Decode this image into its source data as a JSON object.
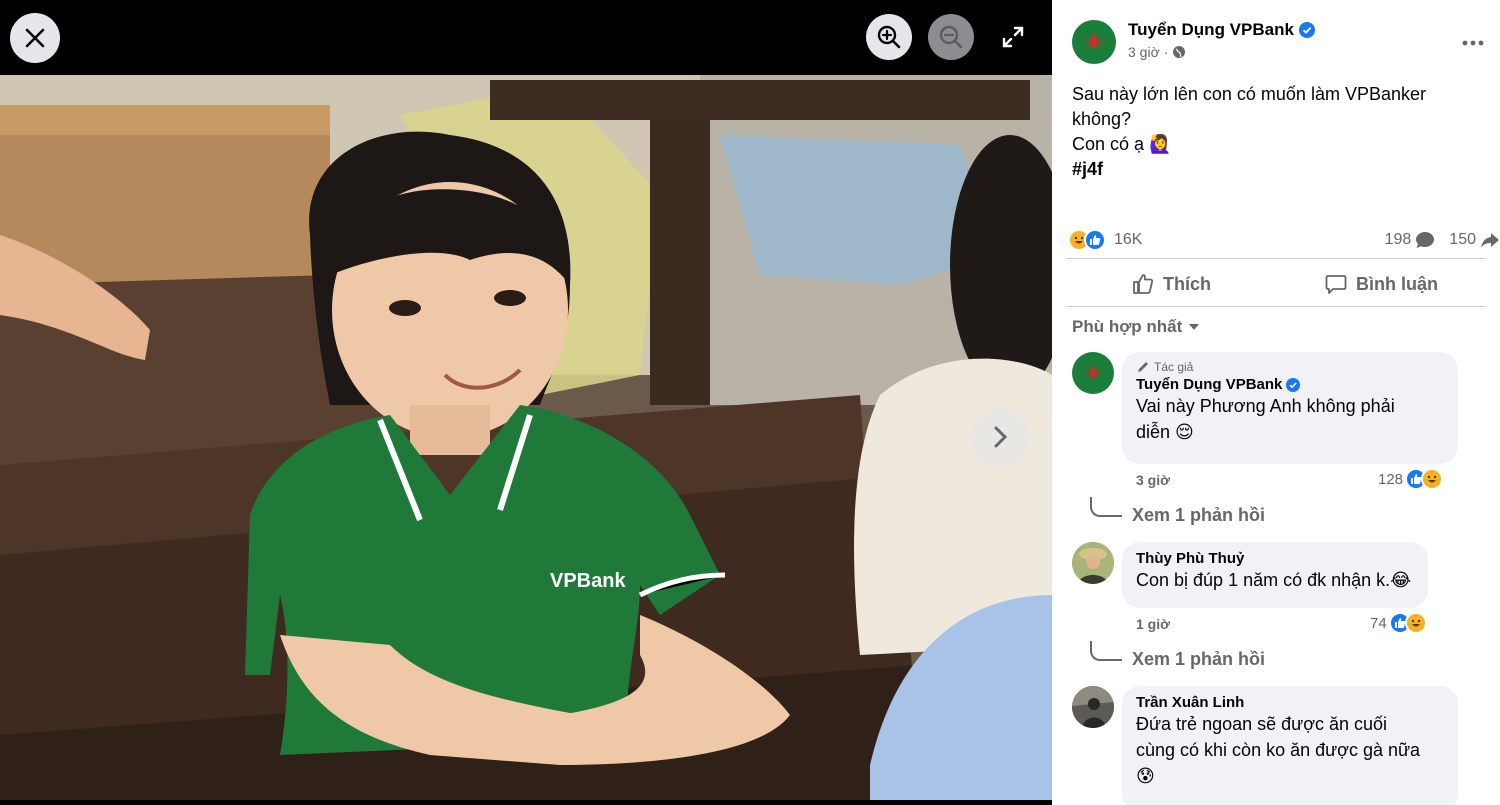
{
  "viewer": {
    "close_icon": "close-icon",
    "zoom_in_icon": "zoom-in-icon",
    "zoom_out_icon": "zoom-out-icon",
    "fullscreen_icon": "fullscreen-icon",
    "next_icon": "chevron-right-icon",
    "photo_shirt_logo": "VPBank"
  },
  "post": {
    "page_name": "Tuyển Dụng VPBank",
    "time": "3 giờ",
    "text_lines": [
      "Sau này lớn lên con có muốn làm VPBanker",
      "không?",
      "Con có ạ 🙋‍♀️"
    ],
    "hashtag": "#j4f",
    "reaction_count": "16K",
    "comment_count": "198",
    "share_count": "150",
    "like_label": "Thích",
    "comment_label": "Bình luận",
    "sort_label": "Phù hợp nhất"
  },
  "comments": [
    {
      "author_tag": "Tác giả",
      "name": "Tuyển Dụng VPBank",
      "text_line1": "Vai này Phương Anh không phải",
      "text_line2": "diễn 😌",
      "time": "3 giờ",
      "reactions": "128",
      "reply_label": "Xem 1 phản hồi"
    },
    {
      "name": "Thùy Phù Thuỷ",
      "text_line1": "Con bị đúp 1 năm có đk nhận k.😂",
      "time": "1 giờ",
      "reactions": "74",
      "reply_label": "Xem 1 phản hồi"
    },
    {
      "name": "Trần Xuân Linh",
      "text_line1": "Đứa trẻ ngoan sẽ được ăn cuối",
      "text_line2": "cùng có khi còn ko ăn được gà nữa",
      "text_line3": "😰"
    }
  ],
  "colors": {
    "brand_green": "#1a7d3a",
    "like_blue": "#1877f2",
    "haha_yellow": "#f7b125",
    "secondary_text": "#65676b",
    "bubble_bg": "#f0f2f5"
  }
}
